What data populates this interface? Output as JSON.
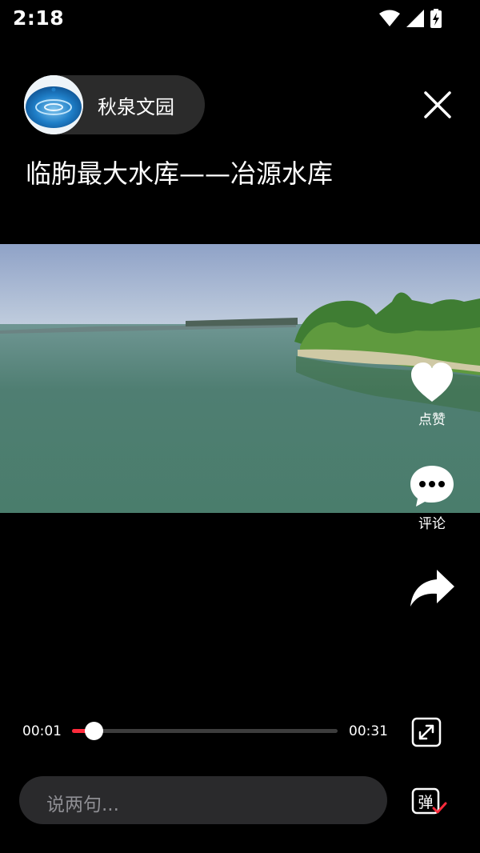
{
  "status_bar": {
    "time": "2:18",
    "icons": [
      "wifi-icon",
      "cellular-signal-icon",
      "battery-charging-icon"
    ]
  },
  "author": {
    "name": "秋泉文园",
    "avatar": "water-drop-avatar"
  },
  "video": {
    "title": "临朐最大水库——冶源水库",
    "current_time": "00:01",
    "total_time": "00:31",
    "progress": 0.08
  },
  "actions": {
    "like_label": "点赞",
    "comment_label": "评论",
    "share_icon": "share-arrow-icon"
  },
  "comment": {
    "placeholder": "说两句..."
  },
  "colors": {
    "background": "#000000",
    "accent": "#ff2b3c",
    "chip_bg": "#2b2b2b",
    "input_bg": "#2a2a2c"
  }
}
